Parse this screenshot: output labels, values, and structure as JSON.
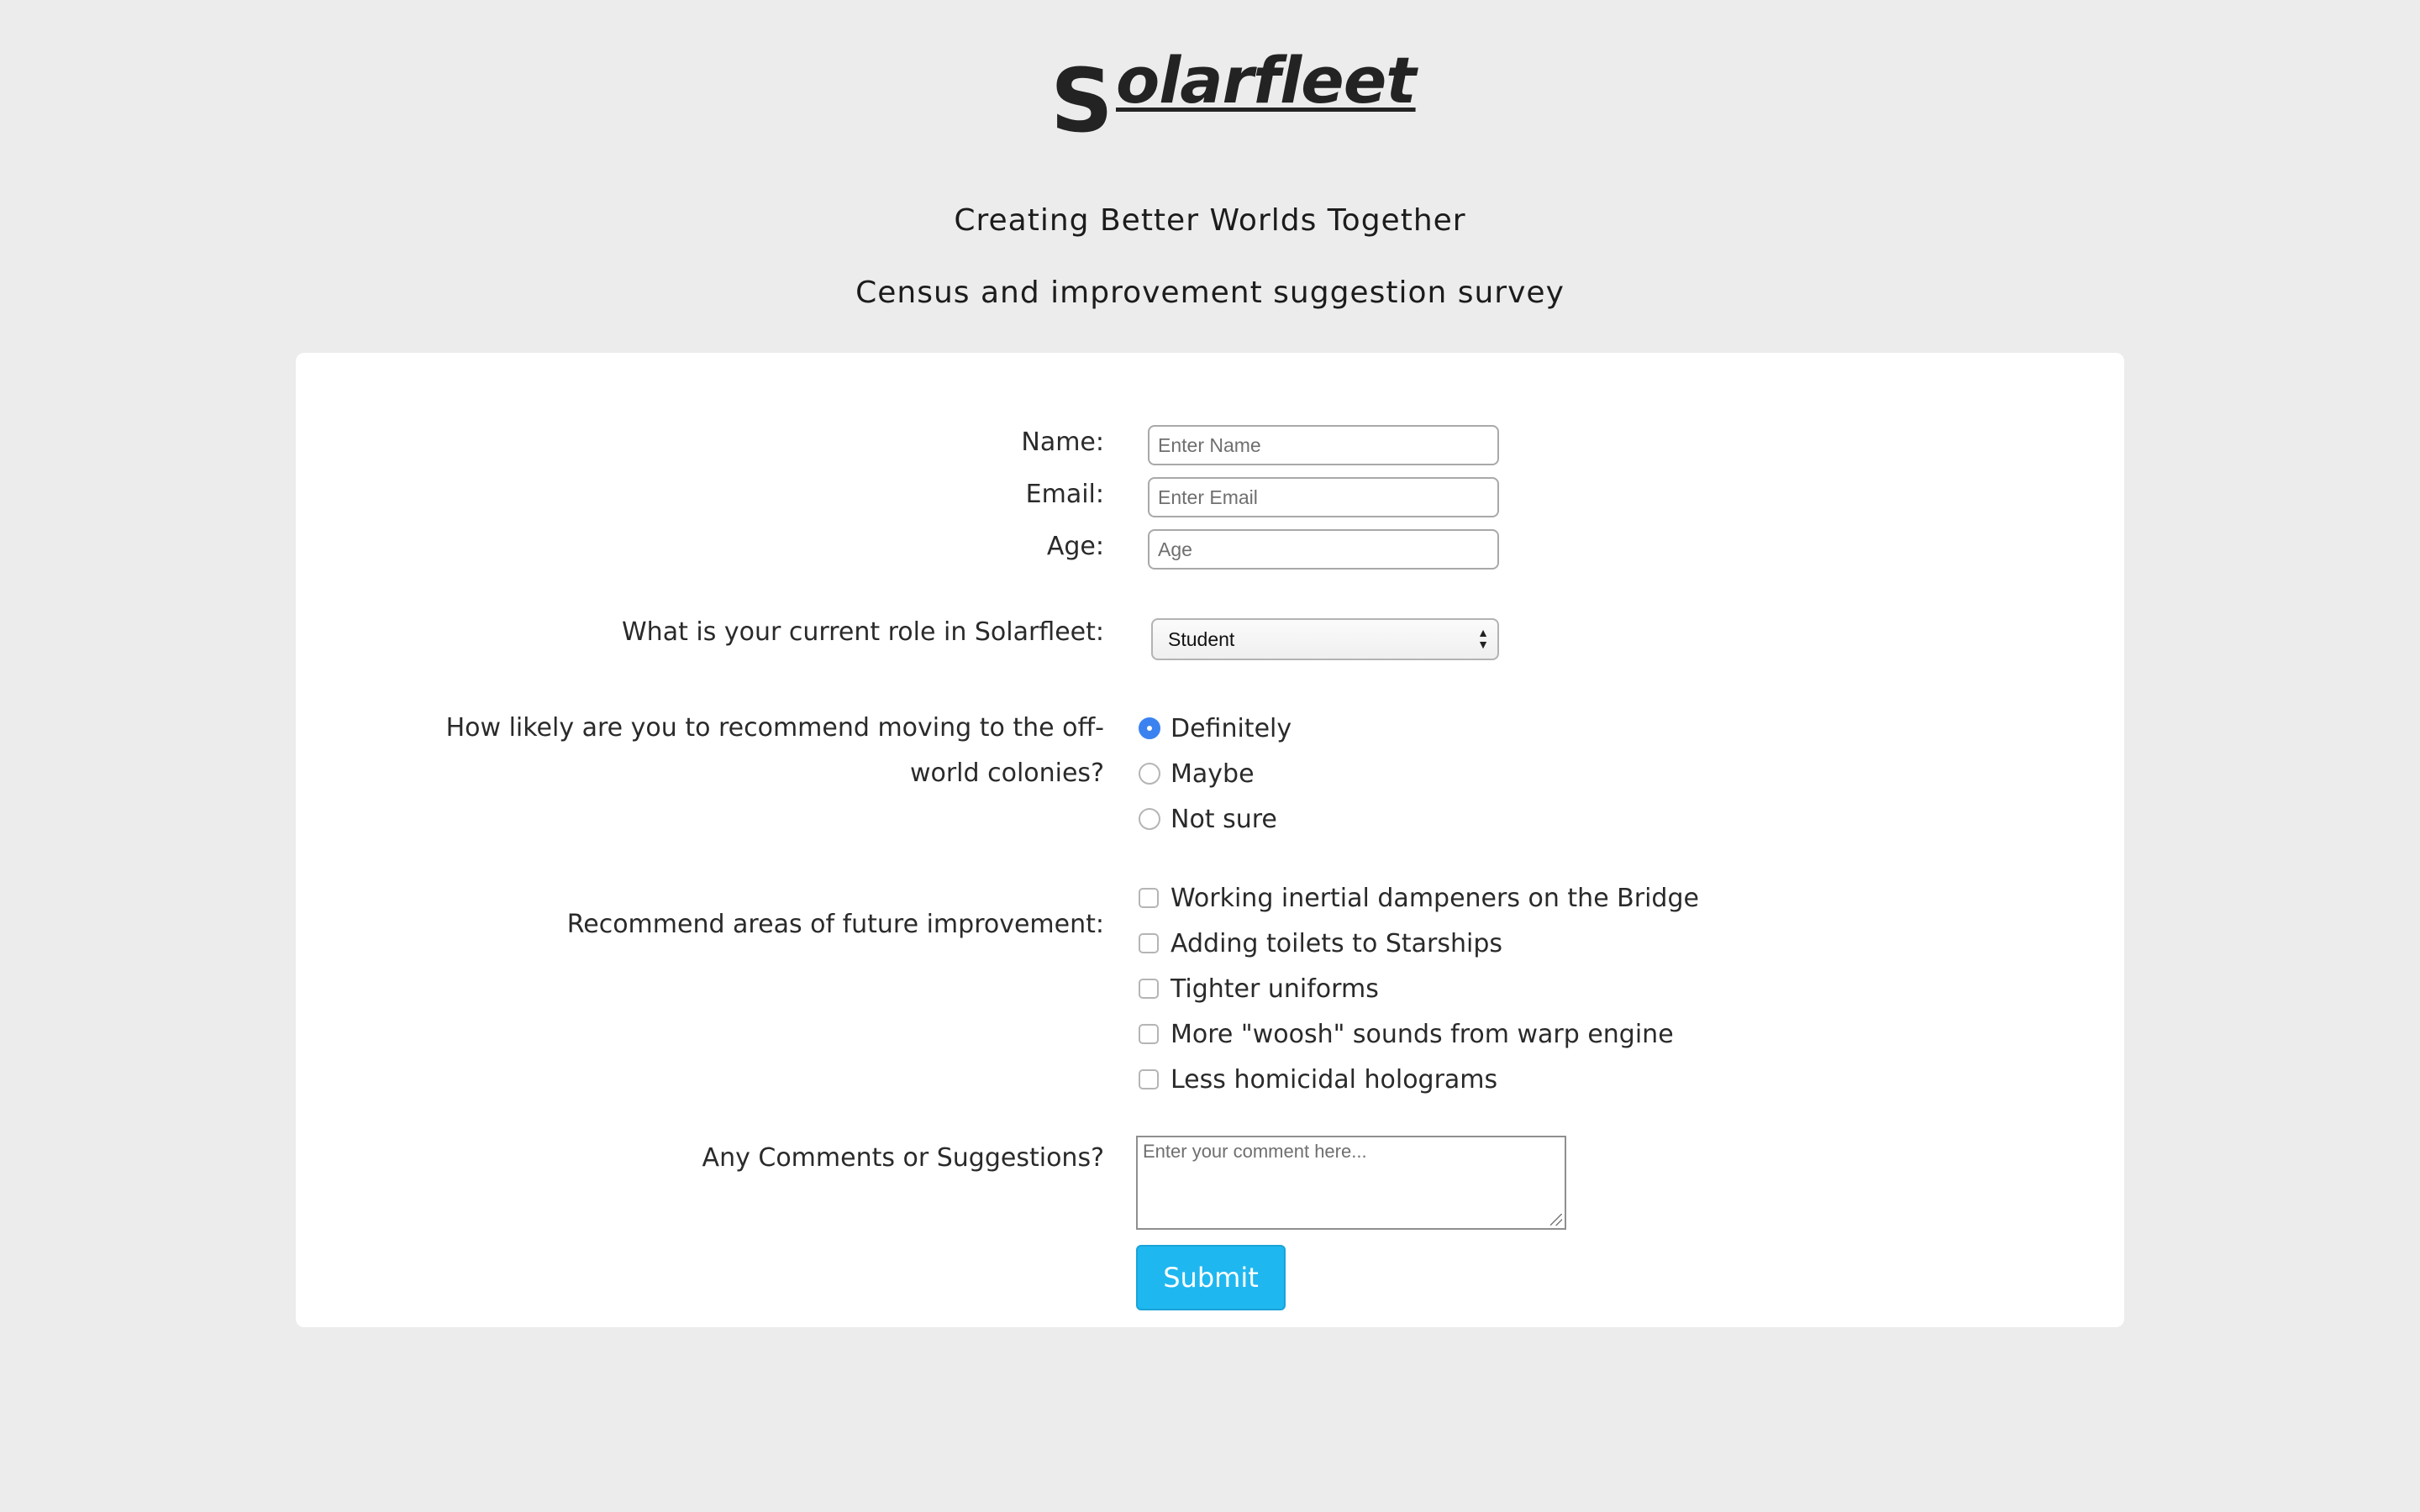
{
  "logo": {
    "first_letter": "S",
    "rest": "olarfleet"
  },
  "header": {
    "tagline": "Creating Better Worlds Together",
    "subtitle": "Census and improvement suggestion survey"
  },
  "form": {
    "name": {
      "label": "Name:",
      "placeholder": "Enter Name",
      "value": ""
    },
    "email": {
      "label": "Email:",
      "placeholder": "Enter Email",
      "value": ""
    },
    "age": {
      "label": "Age:",
      "placeholder": "Age",
      "value": ""
    },
    "role": {
      "label": "What is your current role in Solarfleet:",
      "selected": "Student"
    },
    "recommend": {
      "label_line1": "How likely are you to recommend moving to the off-",
      "label_line2": "world colonies?",
      "options": [
        {
          "label": "Definitely",
          "checked": true
        },
        {
          "label": "Maybe",
          "checked": false
        },
        {
          "label": "Not sure",
          "checked": false
        }
      ]
    },
    "improvements": {
      "label": "Recommend areas of future improvement:",
      "options": [
        {
          "label": "Working inertial dampeners on the Bridge",
          "checked": false
        },
        {
          "label": "Adding toilets to Starships",
          "checked": false
        },
        {
          "label": "Tighter uniforms",
          "checked": false
        },
        {
          "label": "More \"woosh\" sounds from warp engine",
          "checked": false
        },
        {
          "label": "Less homicidal holograms",
          "checked": false
        }
      ]
    },
    "comments": {
      "label": "Any Comments or Suggestions?",
      "placeholder": "Enter your comment here..."
    },
    "submit_label": "Submit"
  },
  "colors": {
    "page_background": "#ececed",
    "card_background": "#ffffff",
    "submit_button": "#1fb7f0",
    "radio_checked": "#3a82f0"
  },
  "icons": {
    "select_arrows": "updown-chevron-icon",
    "textarea_resize": "resize-grip-icon"
  }
}
